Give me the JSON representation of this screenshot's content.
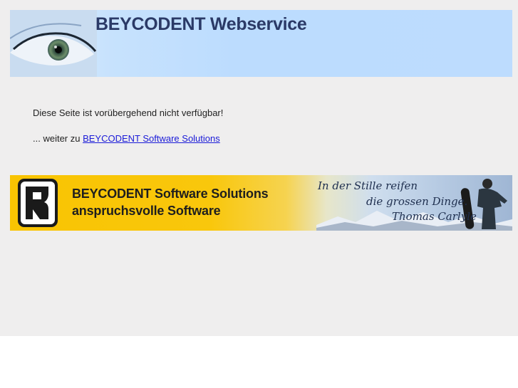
{
  "header": {
    "title": "BEYCODENT Webservice"
  },
  "main": {
    "message": "Diese Seite ist vorübergehend nicht verfügbar!",
    "continue_prefix": "... weiter zu ",
    "continue_link": "BEYCODENT Software Solutions "
  },
  "footer_banner": {
    "title_line1": "BEYCODENT Software Solutions",
    "title_line2": "anspruchsvolle Software",
    "quote_line1": "In der Stille reifen",
    "quote_line2": "die grossen Dinge.",
    "quote_line3": "Thomas Carlyle"
  },
  "colors": {
    "page_background": "#efeeee",
    "header_banner": "#bddcfe",
    "footer_banner": "#f9c402",
    "link": "#1a1ad8"
  }
}
